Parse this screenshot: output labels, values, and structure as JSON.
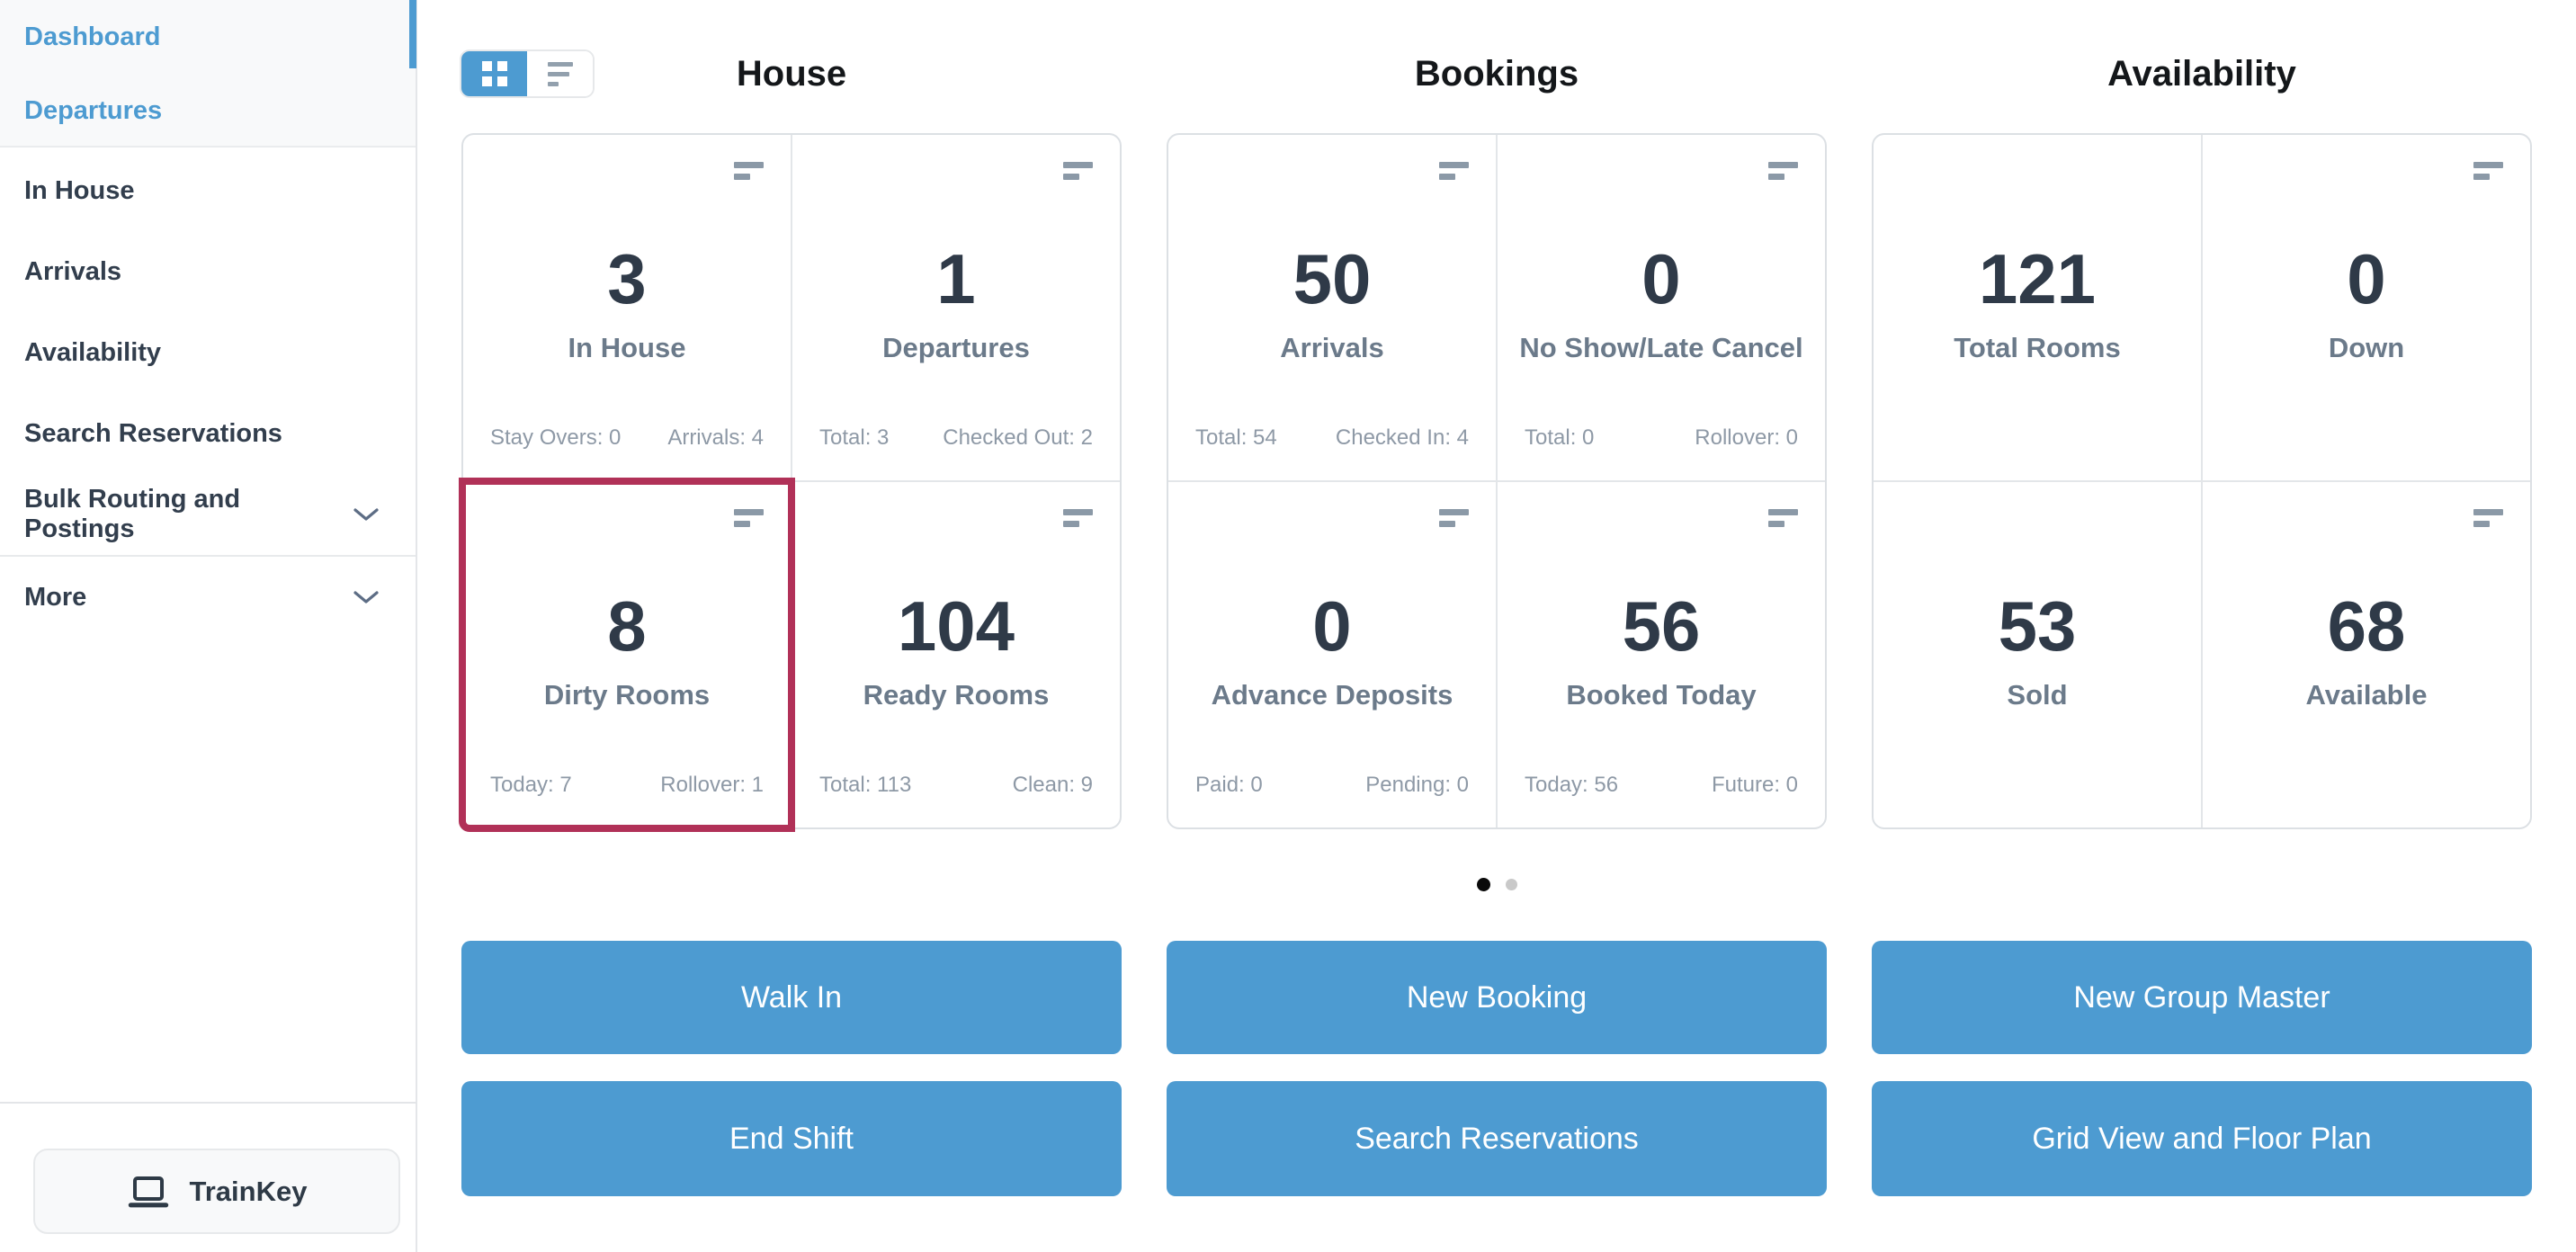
{
  "sidebar": {
    "top_items": [
      {
        "label": "Dashboard",
        "active": true
      },
      {
        "label": "Departures",
        "active": true
      }
    ],
    "items": [
      {
        "label": "In House"
      },
      {
        "label": "Arrivals"
      },
      {
        "label": "Availability"
      },
      {
        "label": "Search Reservations"
      },
      {
        "label": "Bulk Routing and Postings",
        "chevron": "chevron-down"
      },
      {
        "label": "More",
        "chevron": "chevron-down"
      }
    ],
    "trainkey_label": "TrainKey"
  },
  "view_toggle": {
    "active_view": "grid",
    "options": [
      "grid-view",
      "list-view"
    ]
  },
  "sections": [
    {
      "title": "House",
      "cards": [
        {
          "value": "3",
          "label": "In House",
          "stat_left": "Stay Overs: 0",
          "stat_right": "Arrivals: 4"
        },
        {
          "value": "1",
          "label": "Departures",
          "stat_left": "Total: 3",
          "stat_right": "Checked Out: 2"
        },
        {
          "value": "8",
          "label": "Dirty Rooms",
          "stat_left": "Today: 7",
          "stat_right": "Rollover: 1",
          "highlighted": true
        },
        {
          "value": "104",
          "label": "Ready Rooms",
          "stat_left": "Total: 113",
          "stat_right": "Clean: 9"
        }
      ],
      "buttons": [
        "Walk In",
        "End Shift"
      ]
    },
    {
      "title": "Bookings",
      "cards": [
        {
          "value": "50",
          "label": "Arrivals",
          "stat_left": "Total: 54",
          "stat_right": "Checked In: 4"
        },
        {
          "value": "0",
          "label": "No Show/Late Cancel",
          "stat_left": "Total: 0",
          "stat_right": "Rollover: 0"
        },
        {
          "value": "0",
          "label": "Advance Deposits",
          "stat_left": "Paid: 0",
          "stat_right": "Pending: 0"
        },
        {
          "value": "56",
          "label": "Booked Today",
          "stat_left": "Today: 56",
          "stat_right": "Future: 0"
        }
      ],
      "buttons": [
        "New Booking",
        "Search Reservations"
      ]
    },
    {
      "title": "Availability",
      "cards": [
        {
          "value": "121",
          "label": "Total Rooms"
        },
        {
          "value": "0",
          "label": "Down"
        },
        {
          "value": "53",
          "label": "Sold"
        },
        {
          "value": "68",
          "label": "Available"
        }
      ],
      "buttons": [
        "New Group Master",
        "Grid View and Floor Plan"
      ]
    }
  ],
  "pagination": {
    "total_dots": 2,
    "active_dot": 1
  },
  "colors": {
    "accent_blue": "#4d9bd1",
    "highlight_red": "#b13158",
    "number_dark": "#2f3a48",
    "label_slate": "#6b7a8a",
    "stat_gray": "#8e99a6",
    "border_gray": "#dce0e4",
    "sidebar_top_bg": "#f8f9fa"
  }
}
